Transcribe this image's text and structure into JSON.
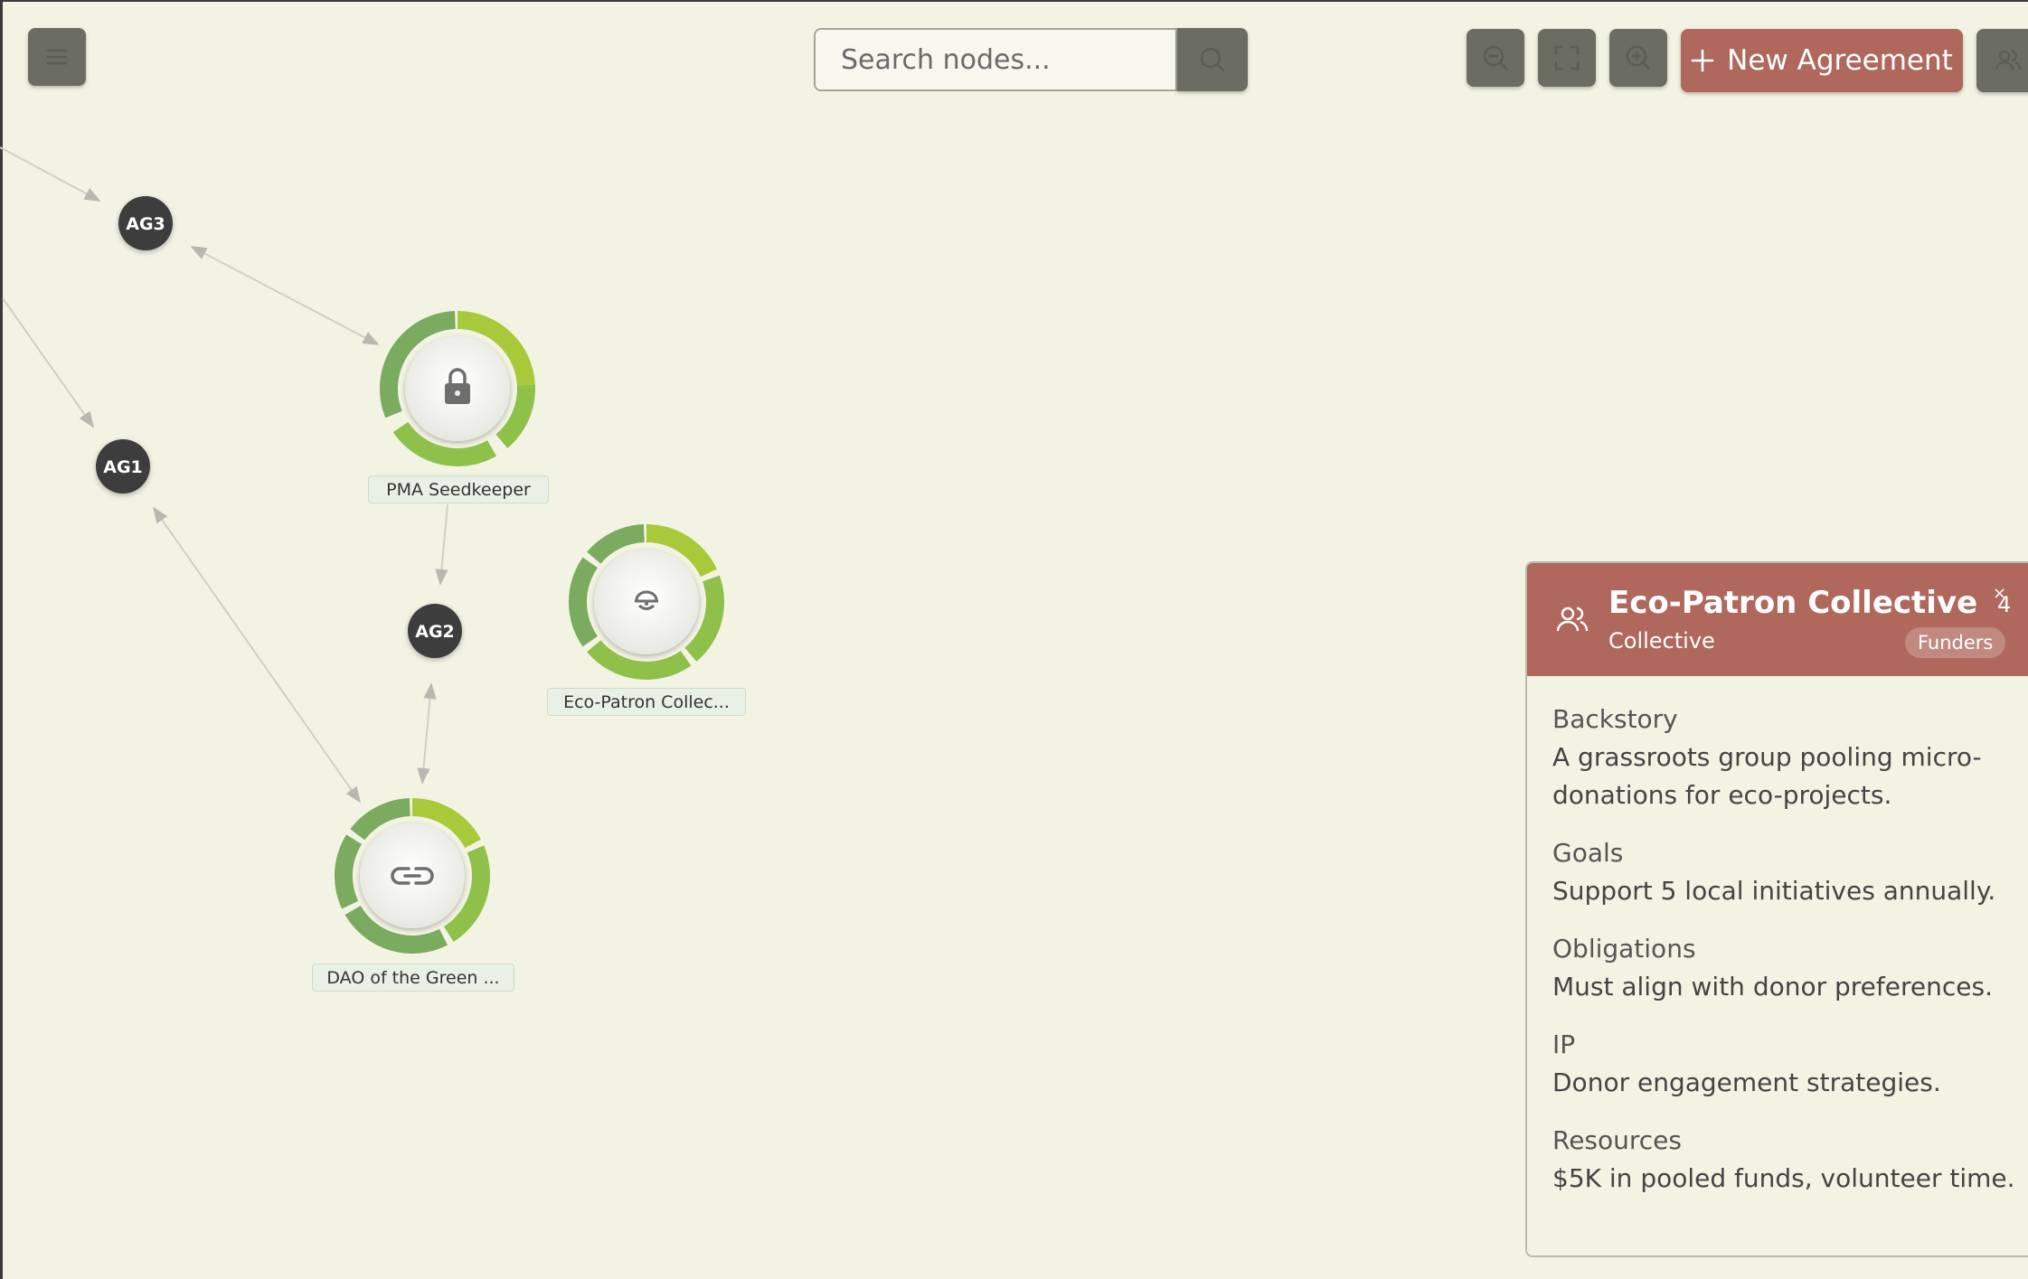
{
  "toolbar": {
    "menu_icon": "hamburger-icon",
    "search_placeholder": "Search nodes...",
    "search_icon": "search-icon",
    "zoom_out_icon": "zoom-out-icon",
    "fit_icon": "fullscreen-icon",
    "zoom_in_icon": "zoom-in-icon",
    "new_agreement_icon": "plus-icon",
    "new_agreement_label": "New Agreement",
    "users_icon": "users-icon"
  },
  "graph": {
    "agreements": [
      {
        "label": "AG3"
      },
      {
        "label": "AG1"
      },
      {
        "label": "AG2"
      }
    ],
    "nodes": [
      {
        "label": "PMA Seedkeeper",
        "icon": "lock-icon"
      },
      {
        "label": "Eco-Patron Collec...",
        "icon": "collective-icon"
      },
      {
        "label": "DAO of the Green ...",
        "icon": "link-icon"
      }
    ]
  },
  "panel": {
    "title": "Eco-Patron Collective",
    "subtitle": "Collective",
    "badge": "Funders",
    "count": "4",
    "close_icon": "close-icon",
    "icon": "users-icon",
    "sections": [
      {
        "title": "Backstory",
        "text": "A grassroots group pooling micro-donations for eco-projects."
      },
      {
        "title": "Goals",
        "text": "Support 5 local initiatives annually."
      },
      {
        "title": "Obligations",
        "text": "Must align with donor preferences."
      },
      {
        "title": "IP",
        "text": "Donor engagement strategies."
      },
      {
        "title": "Resources",
        "text": "$5K in pooled funds, volunteer time."
      }
    ]
  },
  "colors": {
    "background": "#f3f3e4",
    "accent": "#b0685d",
    "tool_button": "#6b6d63",
    "ring_dark": "#7aab5f",
    "ring_mid": "#8ec04a",
    "ring_light": "#a7c93a",
    "agreement_node": "#3c3c3c"
  }
}
